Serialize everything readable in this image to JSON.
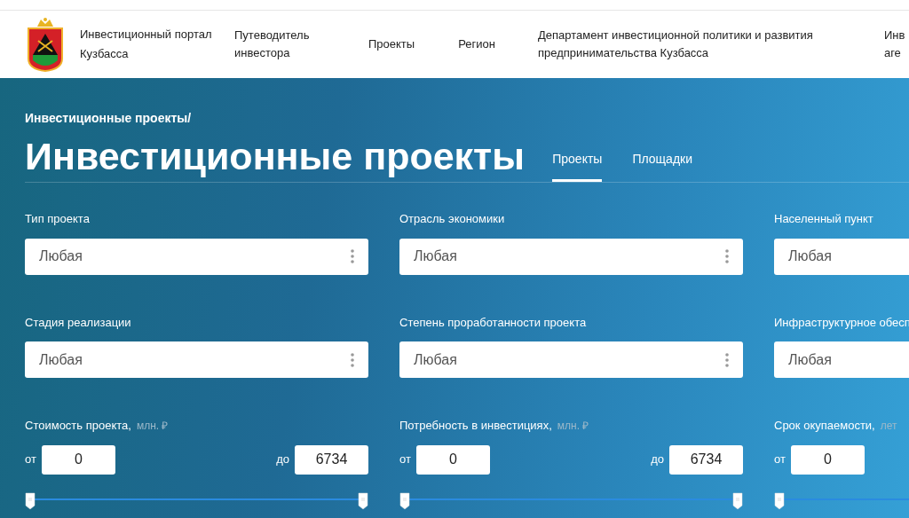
{
  "header": {
    "logo_text": "Инвестиционный портал Кузбасса",
    "nav": [
      "Путеводитель инвестора",
      "Проекты",
      "Регион",
      "Департамент инвестиционной политики и развития предпринимательства Кузбасса",
      "Инв аге"
    ]
  },
  "breadcrumb": "Инвестиционные проекты/",
  "title": "Инвестиционные проекты",
  "tabs": [
    {
      "label": "Проекты",
      "selected": true
    },
    {
      "label": "Площадки",
      "selected": false
    }
  ],
  "filters": [
    {
      "kind": "select",
      "label": "Тип проекта",
      "value": "Любая"
    },
    {
      "kind": "select",
      "label": "Отрасль экономики",
      "value": "Любая"
    },
    {
      "kind": "select",
      "label": "Населенный пункт",
      "value": "Любая"
    },
    {
      "kind": "select",
      "label": "Стадия реализации",
      "value": "Любая"
    },
    {
      "kind": "select",
      "label": "Степень проработанности проекта",
      "value": "Любая"
    },
    {
      "kind": "select",
      "label": "Инфраструктурное обесп",
      "value": "Любая"
    },
    {
      "kind": "range",
      "label": "Стоимость проекта,",
      "unit": "млн. ₽",
      "from_label": "от",
      "from_value": "0",
      "to_label": "до",
      "to_value": "6734",
      "thumbs": [
        {
          "level": 0
        },
        {
          "level": 1
        }
      ]
    },
    {
      "kind": "range",
      "label": "Потребность в инвестициях,",
      "unit": "млн. ₽",
      "from_label": "от",
      "from_value": "0",
      "to_label": "до",
      "to_value": "6734",
      "thumbs": [
        {
          "level": 0
        },
        {
          "level": 1
        }
      ]
    },
    {
      "kind": "range",
      "label": "Срок окупаемости,",
      "unit": "лет",
      "from_label": "от",
      "from_value": "0",
      "thumbs": [
        {
          "level": 0
        }
      ]
    }
  ]
}
